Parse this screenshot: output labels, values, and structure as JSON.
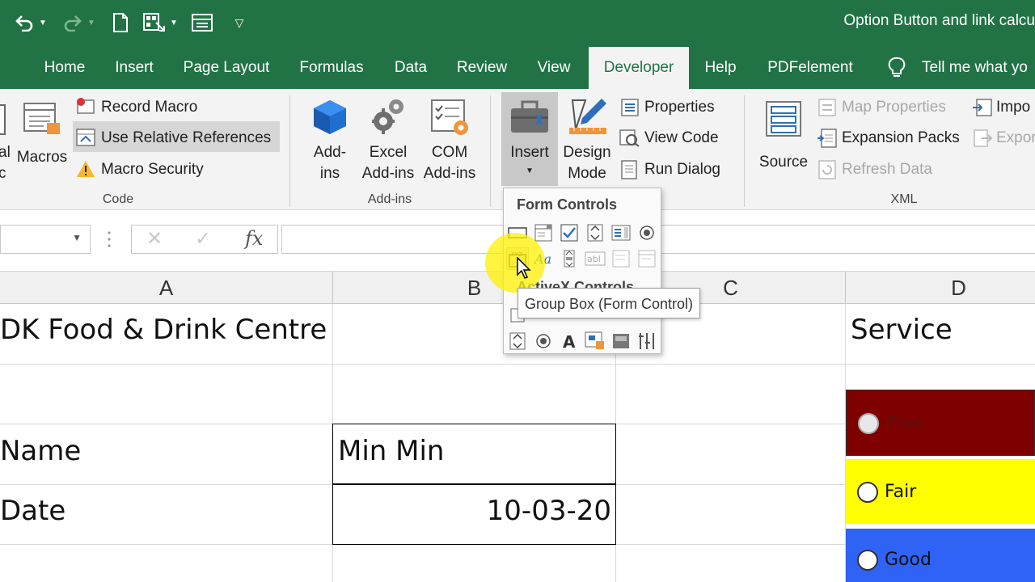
{
  "window": {
    "doc_title": "Option Button and link calcu"
  },
  "colors": {
    "excel_green": "#217346",
    "poor_fill": "#7f0000",
    "fair_fill": "#ffff00",
    "good_fill": "#2f63f5"
  },
  "tabs": [
    "Home",
    "Insert",
    "Page Layout",
    "Formulas",
    "Data",
    "Review",
    "View",
    "Developer",
    "Help",
    "PDFelement"
  ],
  "tell_me": "Tell me what yo",
  "ribbon": {
    "code": {
      "partial_top": "al",
      "partial_bottom": "c",
      "macros": "Macros",
      "record_macro": "Record Macro",
      "use_relative": "Use Relative References",
      "macro_security": "Macro Security",
      "label": "Code"
    },
    "addins": {
      "addins_top": "Add-",
      "addins_bottom": "ins",
      "excel_top": "Excel",
      "excel_bottom": "Add-ins",
      "com_top": "COM",
      "com_bottom": "Add-ins",
      "label": "Add-ins"
    },
    "controls": {
      "insert": "Insert",
      "design_top": "Design",
      "design_bottom": "Mode",
      "properties": "Properties",
      "view_code": "View Code",
      "run_dialog": "Run Dialog"
    },
    "xml": {
      "source": "Source",
      "map_properties": "Map Properties",
      "expansion_packs": "Expansion Packs",
      "refresh_data": "Refresh Data",
      "import": "Impo",
      "export": "Expor",
      "label": "XML"
    }
  },
  "formula_bar": {
    "fx": "fx",
    "cancel": "✕",
    "enter": "✓"
  },
  "columns": [
    "A",
    "B",
    "C",
    "D"
  ],
  "cells": {
    "title": "DK Food & Drink Centre",
    "service": "Service",
    "name_label": "Name",
    "name_value": "Min Min",
    "date_label": "Date",
    "date_value": "10-03-20"
  },
  "options": [
    "Poor",
    "Fair",
    "Good"
  ],
  "dropdown": {
    "form_controls": "Form Controls",
    "activex_controls": "ActiveX Controls",
    "tooltip": "Group Box (Form Control)"
  }
}
